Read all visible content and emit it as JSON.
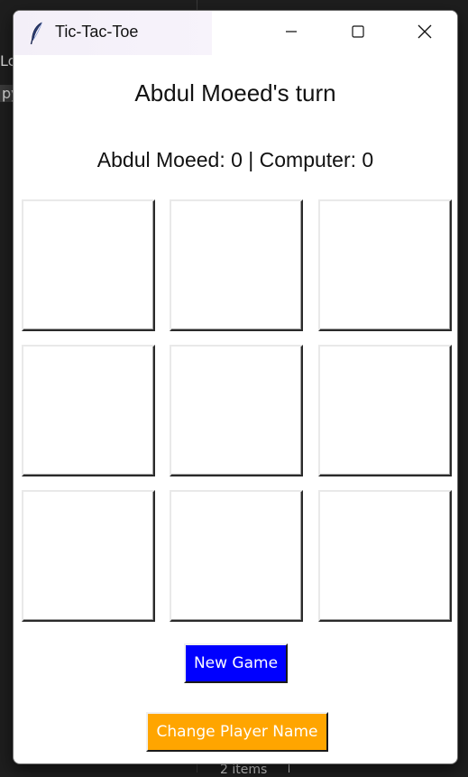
{
  "window": {
    "title": "Tic-Tac-Toe",
    "app_icon": "feather-icon",
    "controls": {
      "minimize_icon": "minimize-icon",
      "maximize_icon": "maximize-icon",
      "close_icon": "close-icon"
    }
  },
  "game": {
    "turn_text": "Abdul Moeed's turn",
    "score_text": "Abdul Moeed: 0 | Computer: 0",
    "board": {
      "rows": [
        [
          "",
          "",
          ""
        ],
        [
          "",
          "",
          ""
        ],
        [
          "",
          "",
          ""
        ]
      ]
    }
  },
  "buttons": {
    "new_game": "New Game",
    "change_player_name": "Change Player Name"
  },
  "colors": {
    "new_game_bg": "#0000ff",
    "change_name_bg": "#ffa500",
    "button_text": "#ffffff"
  },
  "background": {
    "left_text_1": "Lo",
    "left_text_2": "py",
    "status_text": "2 items"
  }
}
